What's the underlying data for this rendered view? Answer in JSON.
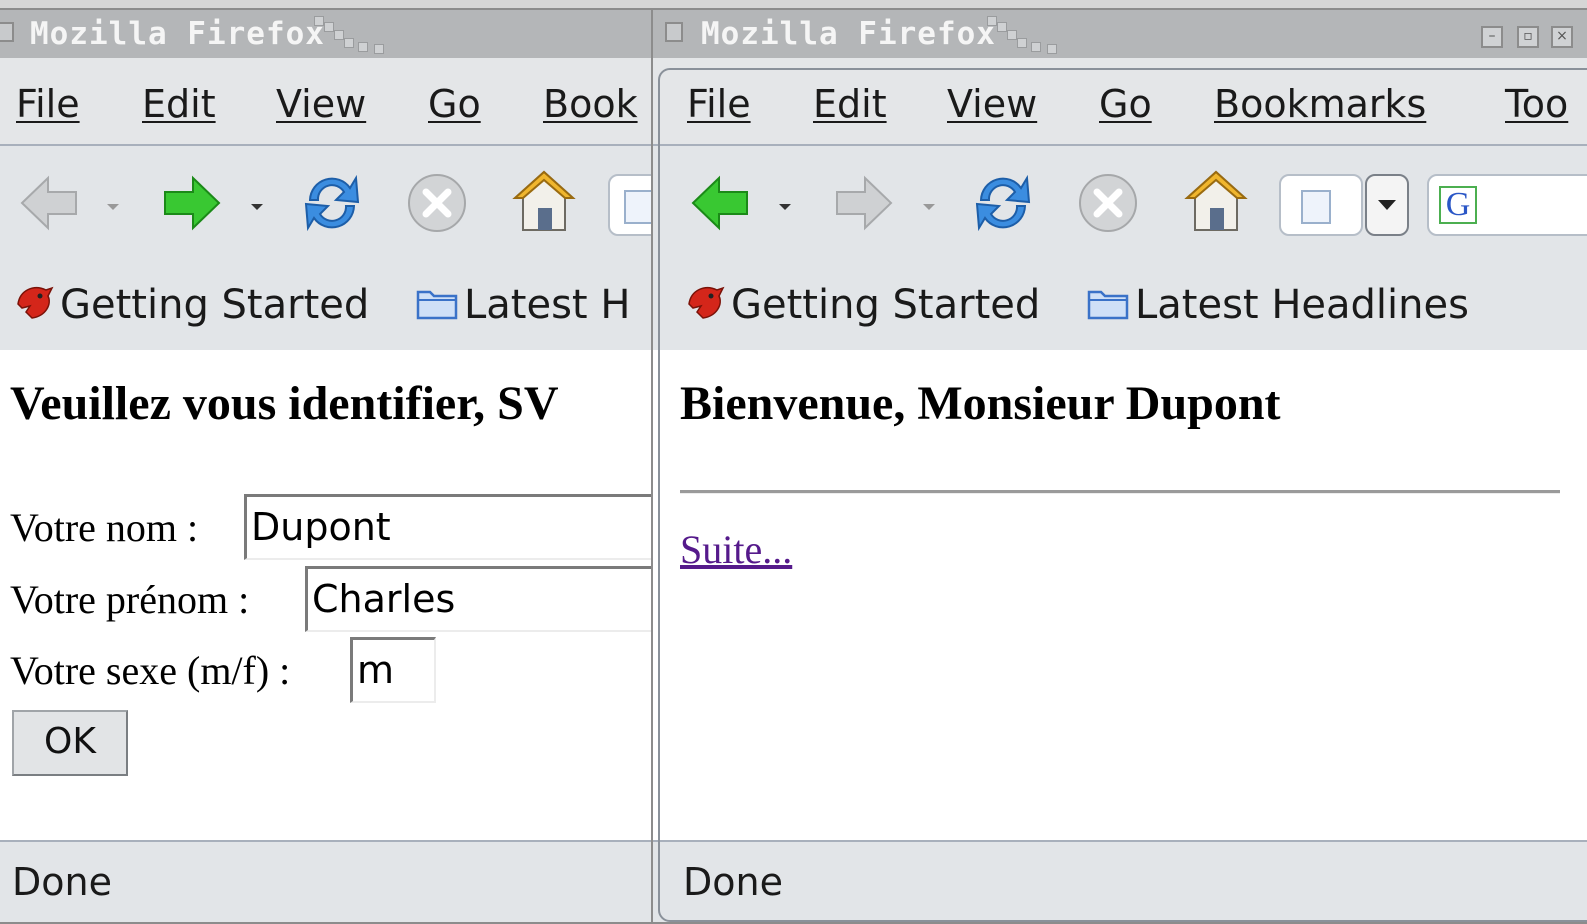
{
  "left_window": {
    "title": "Mozilla Firefox",
    "menu": {
      "file": "File",
      "edit": "Edit",
      "view": "View",
      "go": "Go",
      "bookmarks": "Book"
    },
    "bookmarks": {
      "getting_started": "Getting Started",
      "latest_headlines": "Latest H"
    },
    "page": {
      "heading": "Veuillez vous identifier, SV",
      "nom_label": "Votre nom :",
      "nom_value": "Dupont",
      "prenom_label": "Votre prénom :",
      "prenom_value": "Charles",
      "sexe_label": "Votre sexe (m/f) :",
      "sexe_value": "m",
      "ok_label": "OK"
    },
    "status": "Done"
  },
  "right_window": {
    "title": "Mozilla Firefox",
    "menu": {
      "file": "File",
      "edit": "Edit",
      "view": "View",
      "go": "Go",
      "bookmarks": "Bookmarks",
      "tools": "Too"
    },
    "bookmarks": {
      "getting_started": "Getting Started",
      "latest_headlines": "Latest Headlines"
    },
    "search_engine": "G",
    "page": {
      "heading": "Bienvenue, Monsieur Dupont",
      "link": "Suite..."
    },
    "status": "Done"
  },
  "icons": [
    "back-arrow-icon",
    "forward-arrow-icon",
    "reload-icon",
    "stop-icon",
    "home-icon",
    "page-icon",
    "google-search-icon",
    "getting-started-icon",
    "folder-icon",
    "minimize-icon",
    "maximize-icon",
    "close-icon"
  ],
  "colors": {
    "nav_green": "#2fbf2a",
    "disabled_gray": "#c4c6c8",
    "reload_blue": "#2f7fd8",
    "link_visited": "#551a8b"
  }
}
